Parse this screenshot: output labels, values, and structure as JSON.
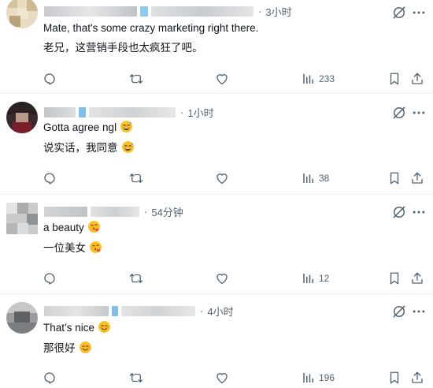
{
  "replies": [
    {
      "time": "3小时",
      "text_en": "Mate, that's some crazy marketing right there.",
      "text_zh": "老兄，这营销手段也太疯狂了吧。",
      "views": "233",
      "emoji": "none"
    },
    {
      "time": "1小时",
      "text_en": "Gotta agree ngl",
      "text_zh": "说实话，我同意",
      "views": "38",
      "emoji": "grinning-sweat"
    },
    {
      "time": "54分钟",
      "text_en": "a beauty",
      "text_zh": "一位美女",
      "views": "12",
      "emoji": "blowing-kiss"
    },
    {
      "time": "4小时",
      "text_en": "That’s nice",
      "text_zh": "那很好",
      "views": "196",
      "emoji": "smiling-blush"
    }
  ],
  "colors": {
    "muted": "#536471",
    "text": "#0f1419",
    "divider": "#eff3f4",
    "emoji": "#fbbf24"
  }
}
